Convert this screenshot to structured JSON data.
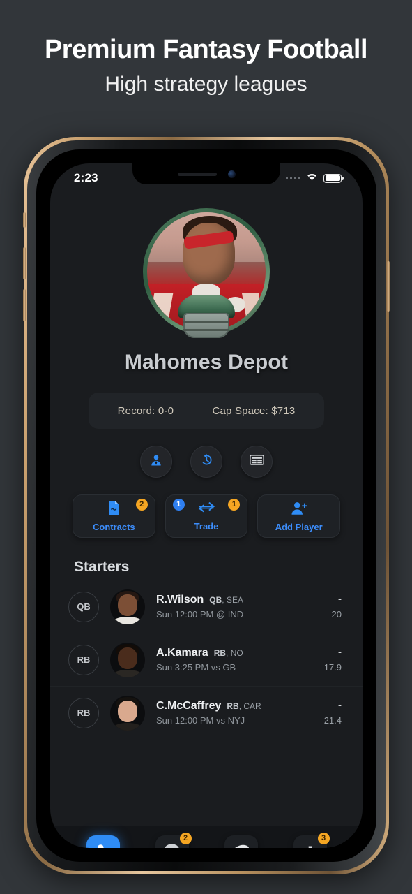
{
  "promo": {
    "title": "Premium Fantasy Football",
    "subtitle": "High strategy leagues"
  },
  "statusbar": {
    "time": "2:23",
    "wifi_icon": "wifi-icon",
    "battery_icon": "battery-icon",
    "signal_icon": "signal-dots-icon"
  },
  "profile": {
    "avatar_icon": "team-avatar",
    "team_name": "Mahomes Depot",
    "record": "Record: 0-0",
    "cap_space": "Cap Space: $713"
  },
  "quick_actions": [
    {
      "name": "roster-manager-button",
      "icon": "person-tie-icon"
    },
    {
      "name": "transaction-history-button",
      "icon": "history-clock-icon"
    },
    {
      "name": "standings-button",
      "icon": "table-list-icon"
    }
  ],
  "actions": [
    {
      "label": "Contracts",
      "icon": "contract-document-icon",
      "badge": "2",
      "badge_color": "#f5a623",
      "badge_pos": "top-right"
    },
    {
      "label": "Trade",
      "icon": "trade-arrows-icon",
      "badge_left": "1",
      "badge_left_color": "#2f7ff0",
      "badge": "1",
      "badge_color": "#f5a623",
      "badge_pos": "both"
    },
    {
      "label": "Add Player",
      "icon": "person-plus-icon",
      "badge": "",
      "badge_color": ""
    }
  ],
  "roster": {
    "section_title": "Starters",
    "players": [
      {
        "slot": "QB",
        "name": "R.Wilson",
        "position": "QB",
        "team": "SEA",
        "game": "Sun 12:00 PM @ IND",
        "score": "-",
        "projection": "20"
      },
      {
        "slot": "RB",
        "name": "A.Kamara",
        "position": "RB",
        "team": "NO",
        "game": "Sun 3:25 PM vs GB",
        "score": "-",
        "projection": "17.9"
      },
      {
        "slot": "RB",
        "name": "C.McCaffrey",
        "position": "RB",
        "team": "CAR",
        "game": "Sun 12:00 PM vs NYJ",
        "score": "-",
        "projection": "21.4"
      }
    ]
  },
  "tabbar": [
    {
      "name": "tab-roster",
      "icon": "person-tag-icon",
      "active": true,
      "badge": ""
    },
    {
      "name": "tab-messages",
      "icon": "chat-bubble-icon",
      "active": false,
      "badge": "2"
    },
    {
      "name": "tab-league",
      "icon": "football-icon",
      "active": false,
      "badge": ""
    },
    {
      "name": "tab-stats",
      "icon": "bar-chart-icon",
      "active": false,
      "badge": "3"
    }
  ],
  "colors": {
    "accent_blue": "#2f8cf5",
    "badge_orange": "#f5a623",
    "page_bg": "#32363a",
    "screen_bg": "#1a1c1f"
  }
}
